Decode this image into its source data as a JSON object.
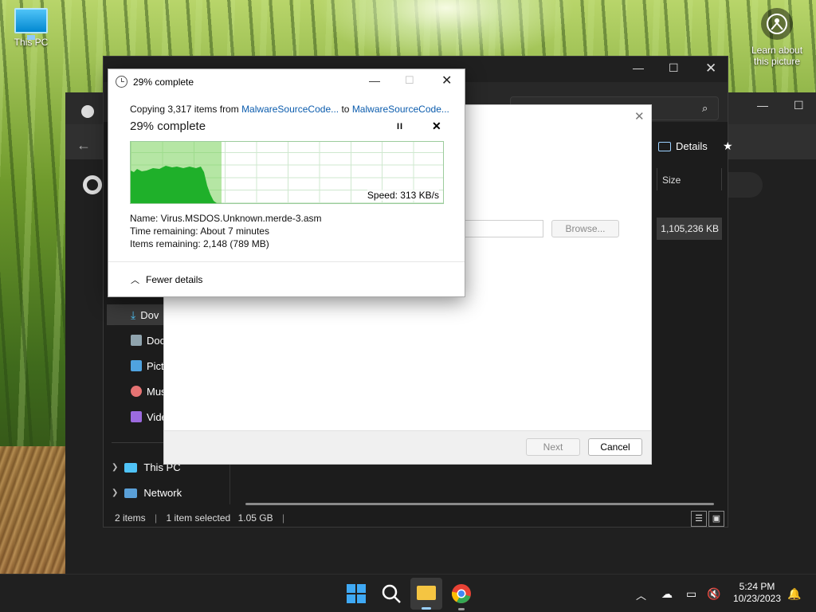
{
  "desktop": {
    "this_pc_label": "This PC",
    "learn_label_1": "Learn about",
    "learn_label_2": "this picture"
  },
  "explorer": {
    "details_label": "Details",
    "size_header": "Size",
    "size_value": "1,105,236 KB",
    "nav": [
      {
        "label": "Dov",
        "icon": "download-icon",
        "color": "#4fc3f7"
      },
      {
        "label": "Doc",
        "icon": "document-icon",
        "color": "#90a4ae"
      },
      {
        "label": "Pict",
        "icon": "pictures-icon",
        "color": "#4fa3e0"
      },
      {
        "label": "Mus",
        "icon": "music-icon",
        "color": "#e57373"
      },
      {
        "label": "Vide",
        "icon": "video-icon",
        "color": "#9c6ade"
      }
    ],
    "tree": [
      {
        "label": "This PC",
        "icon": "this-pc-icon"
      },
      {
        "label": "Network",
        "icon": "network-icon"
      }
    ],
    "status": {
      "items": "2 items",
      "selected": "1 item selected",
      "size": "1.05 GB"
    }
  },
  "wizard": {
    "browse_label": "Browse...",
    "next_label": "Next",
    "cancel_label": "Cancel"
  },
  "copy_dialog": {
    "title": "29% complete",
    "copying_prefix": "Copying 3,317 items from ",
    "source": "MalwareSourceCode...",
    "to_word": " to ",
    "destination": "MalwareSourceCode...",
    "heading": "29% complete",
    "speed": "Speed: 313 KB/s",
    "progress_percent": 29,
    "name_line": "Name:  Virus.MSDOS.Unknown.merde-3.asm",
    "time_line": "Time remaining:  About 7 minutes",
    "items_line": "Items remaining:  2,148 (789 MB)",
    "fewer_details": "Fewer details"
  },
  "taskbar": {
    "time": "5:24 PM",
    "date": "10/23/2023"
  }
}
